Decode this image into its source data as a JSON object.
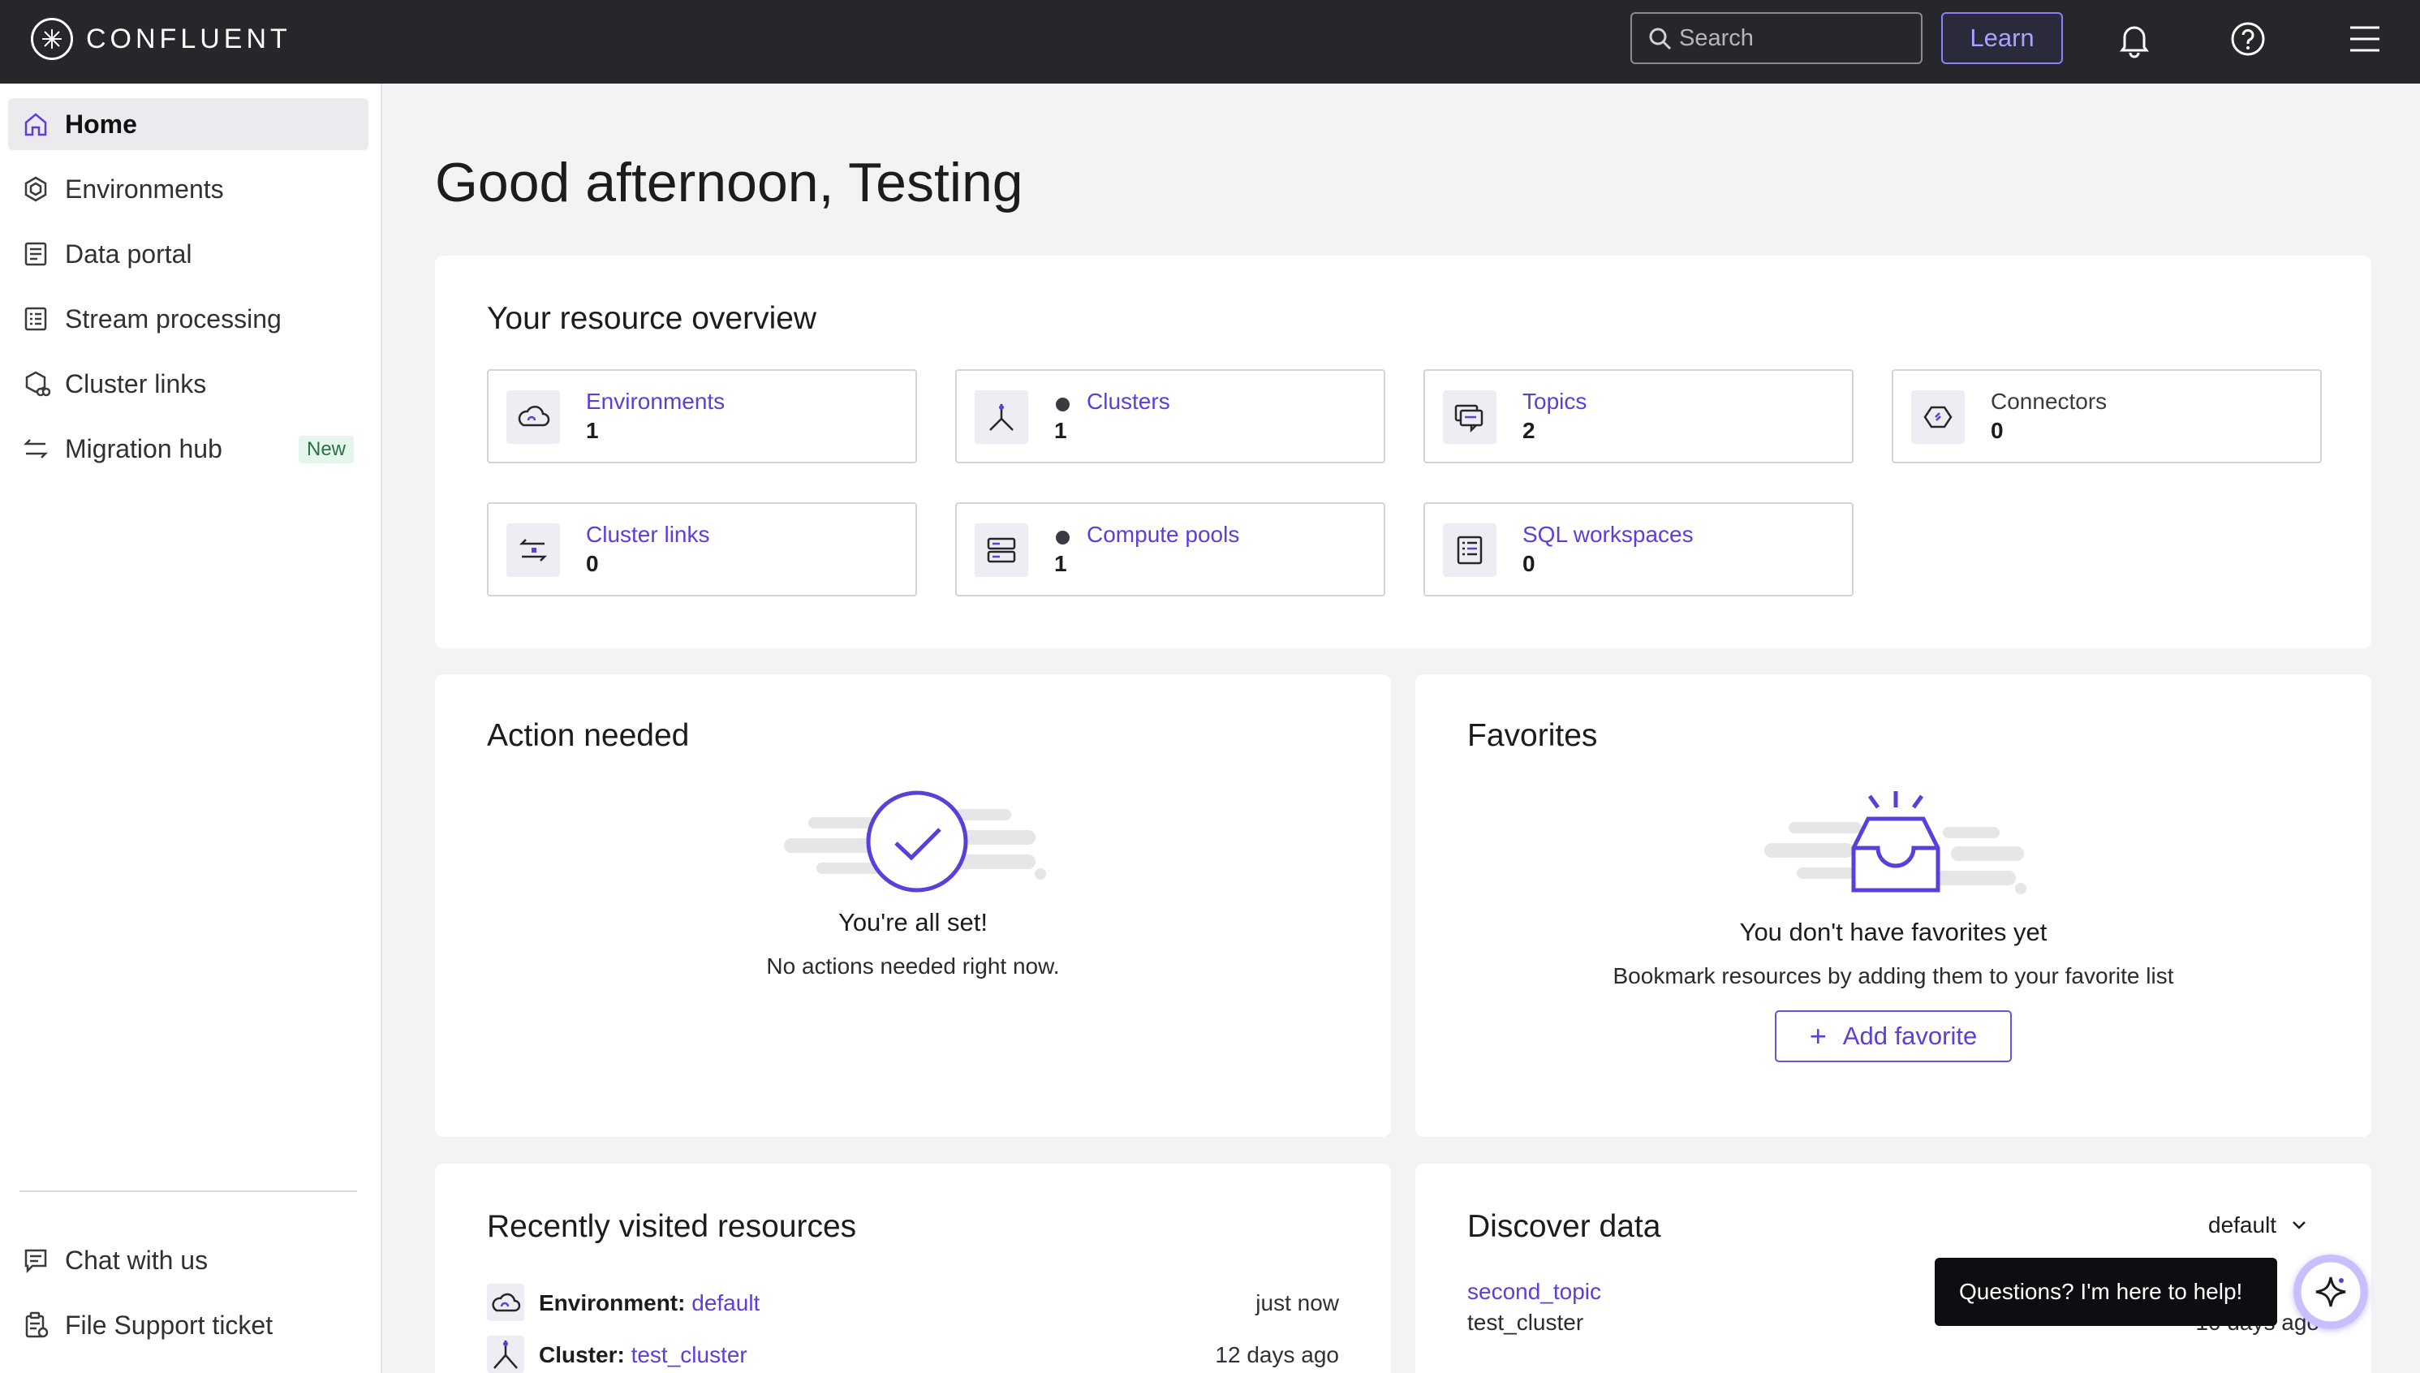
{
  "header": {
    "brand": "CONFLUENT",
    "search_placeholder": "Search",
    "learn_label": "Learn",
    "icons": [
      "bell-icon",
      "help-icon",
      "menu-icon"
    ]
  },
  "sidebar": {
    "items": [
      {
        "label": "Home",
        "icon": "home-icon",
        "active": true
      },
      {
        "label": "Environments",
        "icon": "environments-icon"
      },
      {
        "label": "Data portal",
        "icon": "data-portal-icon"
      },
      {
        "label": "Stream processing",
        "icon": "stream-processing-icon"
      },
      {
        "label": "Cluster links",
        "icon": "cluster-links-icon"
      },
      {
        "label": "Migration hub",
        "icon": "migration-hub-icon",
        "badge": "New"
      }
    ],
    "footer": [
      {
        "label": "Chat with us",
        "icon": "chat-icon"
      },
      {
        "label": "File Support ticket",
        "icon": "support-ticket-icon"
      }
    ]
  },
  "main": {
    "greeting": "Good afternoon, Testing",
    "overview": {
      "title": "Your resource overview",
      "tiles": [
        {
          "label": "Environments",
          "count": "1",
          "icon": "cloud-icon"
        },
        {
          "label": "Clusters",
          "count": "1",
          "icon": "cluster-icon",
          "status_dot": true
        },
        {
          "label": "Topics",
          "count": "2",
          "icon": "topics-icon"
        },
        {
          "label": "Connectors",
          "count": "0",
          "icon": "connector-icon"
        },
        {
          "label": "Cluster links",
          "count": "0",
          "icon": "cluster-links-icon"
        },
        {
          "label": "Compute pools",
          "count": "1",
          "icon": "compute-pool-icon",
          "status_dot": true
        },
        {
          "label": "SQL workspaces",
          "count": "0",
          "icon": "sql-workspace-icon"
        }
      ]
    },
    "action_needed": {
      "title": "Action needed",
      "status": "You're all set!",
      "message": "No actions needed right now."
    },
    "favorites": {
      "title": "Favorites",
      "empty_title": "You don't have favorites yet",
      "empty_message": "Bookmark resources by adding them to your favorite list",
      "add_label": "Add favorite"
    },
    "recent": {
      "title": "Recently visited resources",
      "items": [
        {
          "type": "Environment:",
          "name": "default",
          "time": "just now",
          "icon": "cloud-icon"
        },
        {
          "type": "Cluster:",
          "name": "test_cluster",
          "time": "12 days ago",
          "icon": "cluster-icon"
        }
      ]
    },
    "discover": {
      "title": "Discover data",
      "selected_env": "default",
      "items": [
        {
          "topic": "second_topic",
          "cluster": "test_cluster",
          "time": "10 days ago"
        }
      ]
    }
  },
  "assistant": {
    "tooltip": "Questions? I'm here to help!"
  },
  "colors": {
    "accent": "#5b3fd8",
    "topbar": "#26262b",
    "background": "#f3f3f5"
  }
}
